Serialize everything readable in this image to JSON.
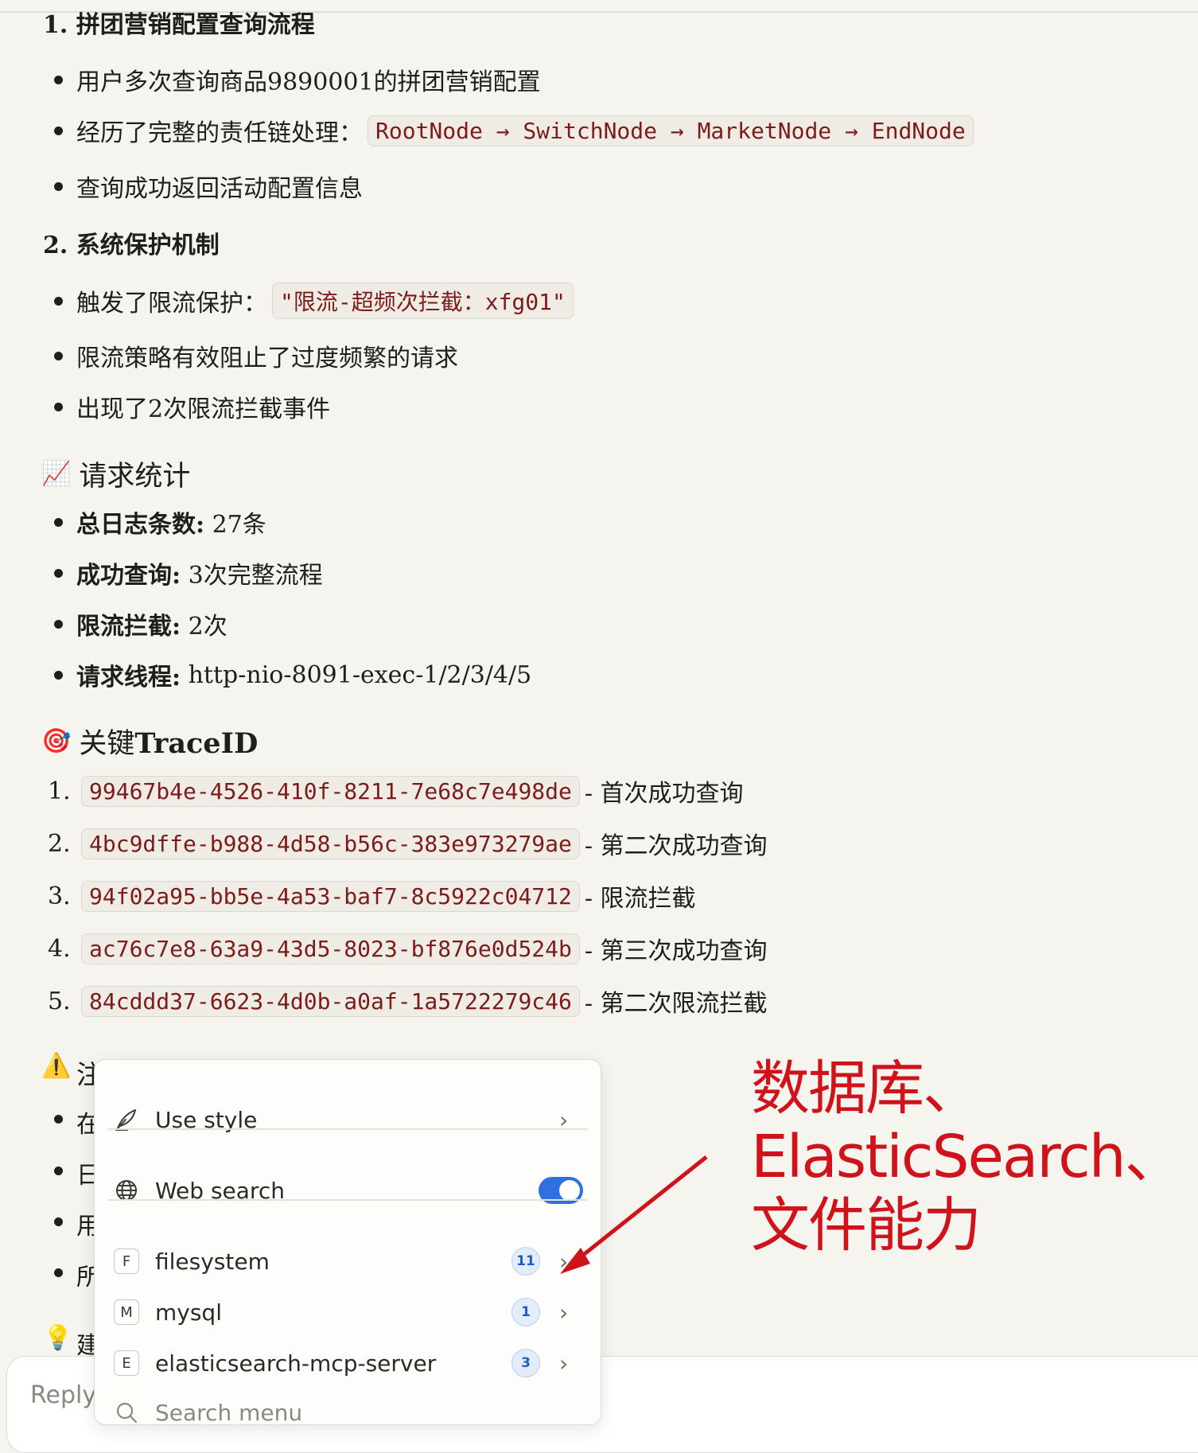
{
  "sections": {
    "h1": "1. 拼团营销配置查询流程",
    "list1": [
      "用户多次查询商品9890001的拼团营销配置",
      "经历了完整的责任链处理：",
      "查询成功返回活动配置信息"
    ],
    "list1_code": "RootNode → SwitchNode → MarketNode → EndNode",
    "h2": "2. 系统保护机制",
    "list2_first": "触发了限流保护：",
    "list2_code": "\"限流-超频次拦截：xfg01\"",
    "list2": [
      "限流策略有效阻止了过度频繁的请求",
      "出现了2次限流拦截事件"
    ]
  },
  "stats": {
    "title": "请求统计",
    "emoji": "📈",
    "items": [
      {
        "label": "总日志条数:",
        "value": " 27条"
      },
      {
        "label": "成功查询:",
        "value": " 3次完整流程"
      },
      {
        "label": "限流拦截:",
        "value": " 2次"
      },
      {
        "label": "请求线程:",
        "value": " http-nio-8091-exec-1/2/3/4/5"
      }
    ]
  },
  "trace": {
    "title_prefix": "关键",
    "title_bold": "TraceID",
    "emoji": "🎯",
    "items": [
      {
        "num": "1.",
        "id": "99467b4e-4526-410f-8211-7e68c7e498de",
        "desc": "- 首次成功查询"
      },
      {
        "num": "2.",
        "id": "4bc9dffe-b988-4d58-b56c-383e973279ae",
        "desc": "- 第二次成功查询"
      },
      {
        "num": "3.",
        "id": "94f02a95-bb5e-4a53-baf7-8c5922c04712",
        "desc": "- 限流拦截"
      },
      {
        "num": "4.",
        "id": "ac76c7e8-63a9-43d5-8023-bf876e0d524b",
        "desc": "- 第三次成功查询"
      },
      {
        "num": "5.",
        "id": "84cddd37-6623-4d0b-a0af-1a5722279c46",
        "desc": "- 第二次限流拦截"
      }
    ]
  },
  "hidden_partial": {
    "warning_emoji": "⚠️",
    "warning_char": "注",
    "bullet_chars": [
      "在",
      "日",
      "用",
      "所"
    ],
    "idea_emoji": "💡",
    "idea_char": "建"
  },
  "menu": {
    "use_style": "Use style",
    "web_search": "Web search",
    "web_search_enabled": true,
    "tools": [
      {
        "letter": "F",
        "name": "filesystem",
        "count": "11"
      },
      {
        "letter": "M",
        "name": "mysql",
        "count": "1"
      },
      {
        "letter": "E",
        "name": "elasticsearch-mcp-server",
        "count": "3"
      }
    ],
    "search_placeholder": "Search menu"
  },
  "reply_placeholder": "Reply",
  "annotation": {
    "lines": [
      "数据库、",
      "ElasticSearch、",
      "文件能力"
    ],
    "color": "#d0121b"
  },
  "colors": {
    "background": "#f5f4ee",
    "code_text": "#7d1b1b",
    "toggle_on": "#2f6fde",
    "badge": "#1f5fc2"
  }
}
